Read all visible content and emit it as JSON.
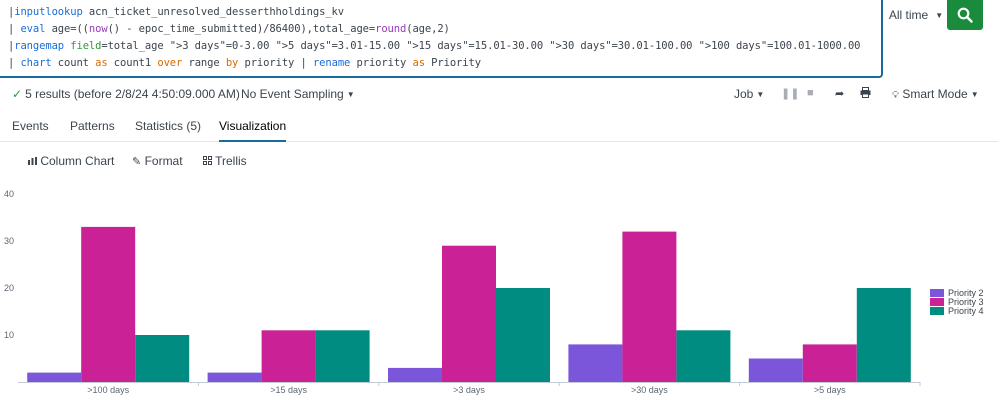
{
  "search": {
    "lines": [
      [
        {
          "t": "|",
          "c": "pipe"
        },
        {
          "t": "inputlookup",
          "c": "kw-cmd"
        },
        {
          "t": " acn_ticket_unresolved_desserthholdings_kv",
          "c": ""
        }
      ],
      [
        {
          "t": "| ",
          "c": "pipe"
        },
        {
          "t": "eval",
          "c": "kw-cmd"
        },
        {
          "t": " age=((",
          "c": ""
        },
        {
          "t": "now",
          "c": "kw-fn"
        },
        {
          "t": "() - epoc_time_submitted)/86400),total_age=",
          "c": ""
        },
        {
          "t": "round",
          "c": "kw-fn"
        },
        {
          "t": "(age,2)",
          "c": ""
        }
      ],
      [
        {
          "t": "|",
          "c": "pipe"
        },
        {
          "t": "rangemap",
          "c": "kw-cmd"
        },
        {
          "t": " ",
          "c": ""
        },
        {
          "t": "field",
          "c": "kw-arg"
        },
        {
          "t": "=total_age \">3 days\"=0-3.00 \">5 days\"=3.01-15.00 \">15 days\"=15.01-30.00 \">30 days\"=30.01-100.00 \">100 days\"=100.01-1000.00",
          "c": ""
        }
      ],
      [
        {
          "t": "| ",
          "c": "pipe"
        },
        {
          "t": "chart",
          "c": "kw-cmd"
        },
        {
          "t": " count ",
          "c": ""
        },
        {
          "t": "as",
          "c": "kw-op"
        },
        {
          "t": " count1 ",
          "c": ""
        },
        {
          "t": "over",
          "c": "kw-op"
        },
        {
          "t": " range ",
          "c": ""
        },
        {
          "t": "by",
          "c": "kw-op"
        },
        {
          "t": " priority | ",
          "c": ""
        },
        {
          "t": "rename",
          "c": "kw-cmd"
        },
        {
          "t": " priority ",
          "c": ""
        },
        {
          "t": "as",
          "c": "kw-op"
        },
        {
          "t": " Priority",
          "c": ""
        }
      ]
    ],
    "time_range": "All time"
  },
  "status": {
    "results": "5 results (before 2/8/24 4:50:09.000 AM)",
    "sampling": "No Event Sampling",
    "job": "Job",
    "mode": "Smart Mode"
  },
  "tabs": [
    {
      "label": "Events",
      "active": false
    },
    {
      "label": "Patterns",
      "active": false
    },
    {
      "label": "Statistics (5)",
      "active": false
    },
    {
      "label": "Visualization",
      "active": true
    }
  ],
  "viz_toolbar": {
    "chart_type": "Column Chart",
    "format": "Format",
    "trellis": "Trellis"
  },
  "chart_data": {
    "type": "bar",
    "categories": [
      ">100 days",
      ">15 days",
      ">3 days",
      ">30 days",
      ">5 days"
    ],
    "series": [
      {
        "name": "Priority 2",
        "color": "#7b56db",
        "values": [
          2,
          2,
          3,
          8,
          5
        ]
      },
      {
        "name": "Priority 3",
        "color": "#cb2196",
        "values": [
          33,
          11,
          29,
          32,
          8
        ]
      },
      {
        "name": "Priority 4",
        "color": "#008c80",
        "values": [
          10,
          11,
          20,
          11,
          20
        ]
      }
    ],
    "ylim": [
      0,
      40
    ],
    "yticks": [
      10,
      20,
      30,
      40
    ],
    "grid": false,
    "legend": "right"
  }
}
